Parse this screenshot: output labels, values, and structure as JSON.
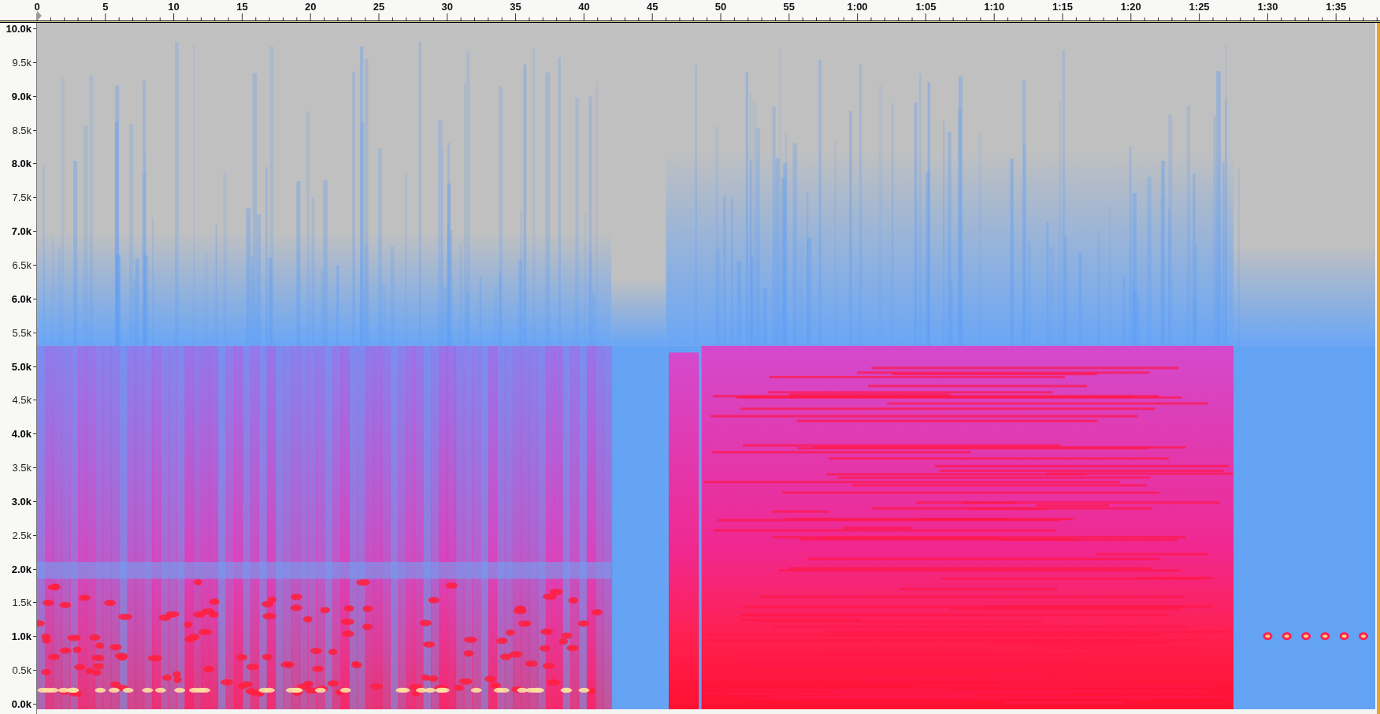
{
  "time_ruler": {
    "labels": [
      "0",
      "5",
      "10",
      "15",
      "20",
      "25",
      "30",
      "35",
      "40",
      "45",
      "50",
      "55",
      "1:00",
      "1:05",
      "1:10",
      "1:15",
      "1:20",
      "1:25",
      "1:30",
      "1:35"
    ]
  },
  "frequency_axis": {
    "labels": [
      {
        "text": "10.0k",
        "major": true
      },
      {
        "text": "9.5k",
        "major": false
      },
      {
        "text": "9.0k",
        "major": true
      },
      {
        "text": "8.5k",
        "major": false
      },
      {
        "text": "8.0k",
        "major": true
      },
      {
        "text": "7.5k",
        "major": false
      },
      {
        "text": "7.0k",
        "major": true
      },
      {
        "text": "6.5k",
        "major": false
      },
      {
        "text": "6.0k",
        "major": true
      },
      {
        "text": "5.5k",
        "major": false
      },
      {
        "text": "5.0k",
        "major": true
      },
      {
        "text": "4.5k",
        "major": false
      },
      {
        "text": "4.0k",
        "major": true
      },
      {
        "text": "3.5k",
        "major": false
      },
      {
        "text": "3.0k",
        "major": true
      },
      {
        "text": "2.5k",
        "major": false
      },
      {
        "text": "2.0k",
        "major": true
      },
      {
        "text": "1.5k",
        "major": false
      },
      {
        "text": "1.0k",
        "major": true
      },
      {
        "text": "0.5k",
        "major": false
      },
      {
        "text": "0.0k",
        "major": true
      }
    ]
  }
}
